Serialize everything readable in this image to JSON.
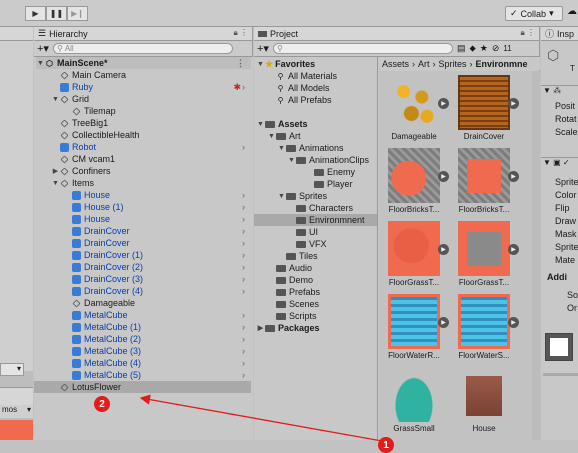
{
  "toolbar": {
    "collab_label": "Collab",
    "play_icons": [
      "play-icon",
      "pause-icon",
      "step-icon"
    ]
  },
  "hierarchy": {
    "tab_label": "Hierarchy",
    "search_placeholder": "All",
    "scene": "MainScene*",
    "items": [
      {
        "label": "Main Camera",
        "blue": false
      },
      {
        "label": "Ruby",
        "blue": true
      },
      {
        "label": "Grid",
        "blue": false
      },
      {
        "label": "Tilemap",
        "blue": false
      },
      {
        "label": "TreeBig1",
        "blue": false
      },
      {
        "label": "CollectibleHealth",
        "blue": false
      },
      {
        "label": "Robot",
        "blue": true
      },
      {
        "label": "CM vcam1",
        "blue": false
      },
      {
        "label": "Confiners",
        "blue": false
      },
      {
        "label": "Items",
        "blue": false
      },
      {
        "label": "House",
        "blue": true
      },
      {
        "label": "House (1)",
        "blue": true
      },
      {
        "label": "House",
        "blue": true
      },
      {
        "label": "DrainCover",
        "blue": true
      },
      {
        "label": "DrainCover",
        "blue": true
      },
      {
        "label": "DrainCover (1)",
        "blue": true
      },
      {
        "label": "DrainCover (2)",
        "blue": true
      },
      {
        "label": "DrainCover (3)",
        "blue": true
      },
      {
        "label": "DrainCover (4)",
        "blue": true
      },
      {
        "label": "Damageable",
        "blue": false
      },
      {
        "label": "MetalCube",
        "blue": true
      },
      {
        "label": "MetalCube (1)",
        "blue": true
      },
      {
        "label": "MetalCube (2)",
        "blue": true
      },
      {
        "label": "MetalCube (3)",
        "blue": true
      },
      {
        "label": "MetalCube (4)",
        "blue": true
      },
      {
        "label": "MetalCube (5)",
        "blue": true
      },
      {
        "label": "LotusFlower",
        "blue": false
      }
    ]
  },
  "project": {
    "tab_label": "Project",
    "badge_count": "11",
    "favorites": {
      "label": "Favorites",
      "items": [
        "All Materials",
        "All Models",
        "All Prefabs"
      ]
    },
    "assets_label": "Assets",
    "tree": [
      "Art",
      "Animations",
      "AnimationClips",
      "Enemy",
      "Player",
      "Sprites",
      "Characters",
      "Environmnent",
      "UI",
      "VFX",
      "Tiles",
      "Audio",
      "Demo",
      "Prefabs",
      "Scenes",
      "Scripts"
    ],
    "packages_label": "Packages",
    "breadcrumb": [
      "Assets",
      "Art",
      "Sprites",
      "Environmne"
    ],
    "assets": [
      "Damageable",
      "DrainCover",
      "FloorBricksT...",
      "FloorBricksT...",
      "FloorGrassT...",
      "FloorGrassT...",
      "FloorWaterR...",
      "FloorWaterS...",
      "GrassSmall",
      "House"
    ]
  },
  "inspector": {
    "tab_label": "Insp",
    "fields": [
      "Posit",
      "Rotat",
      "Scale",
      "Sprite",
      "Color",
      "Flip",
      "Draw",
      "Mask",
      "Sprite",
      "Mate",
      "Addi",
      "So",
      "Or"
    ]
  },
  "left_panel": {
    "label": "mos"
  },
  "annotations": {
    "badge_1": "1",
    "badge_2": "2",
    "arrow_color": "#e31b1b"
  }
}
